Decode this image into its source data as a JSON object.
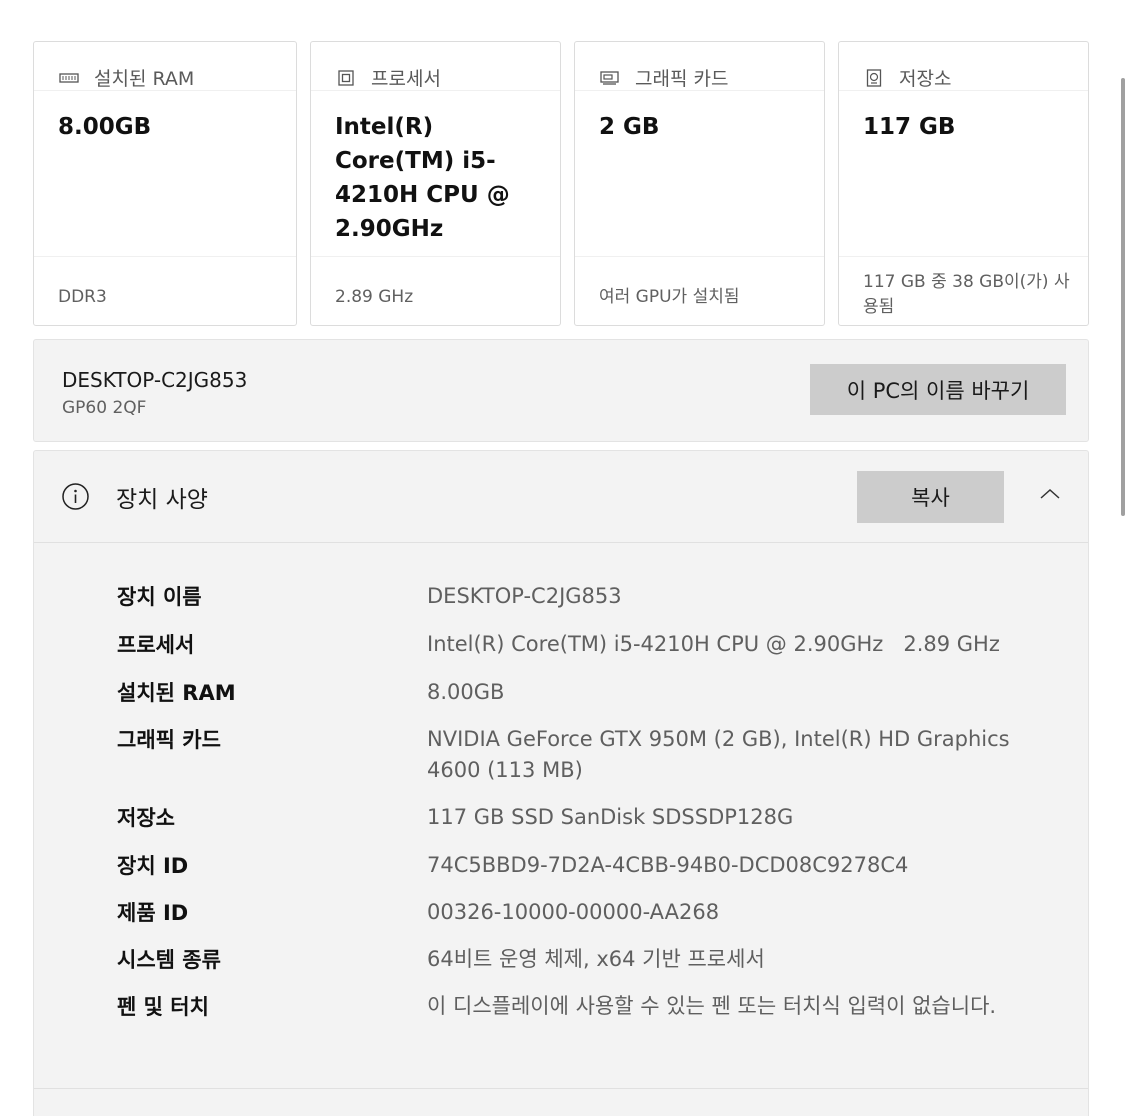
{
  "cards": [
    {
      "title": "설치된 RAM",
      "icon": "ram-icon",
      "value": "8.00GB",
      "footer": "DDR3"
    },
    {
      "title": "프로세서",
      "icon": "processor-icon",
      "value": "Intel(R) Core(TM) i5-4210H CPU @ 2.90GHz",
      "footer": "2.89 GHz"
    },
    {
      "title": "그래픽 카드",
      "icon": "graphics-card-icon",
      "value": "2 GB",
      "footer": "여러 GPU가 설치됨"
    },
    {
      "title": "저장소",
      "icon": "storage-icon",
      "value": "117 GB",
      "footer": "117 GB 중 38 GB이(가) 사용됨"
    }
  ],
  "device": {
    "name": "DESKTOP-C2JG853",
    "model": "GP60 2QF",
    "rename_label": "이 PC의 이름 바꾸기"
  },
  "specs": {
    "title": "장치 사양",
    "copy_label": "복사",
    "rows": [
      {
        "label": "장치 이름",
        "value": "DESKTOP-C2JG853"
      },
      {
        "label": "프로세서",
        "value": "Intel(R) Core(TM) i5-4210H CPU @ 2.90GHz   2.89 GHz"
      },
      {
        "label": "설치된 RAM",
        "value": "8.00GB"
      },
      {
        "label": "그래픽 카드",
        "value": "NVIDIA GeForce GTX 950M (2 GB), Intel(R) HD Graphics 4600 (113 MB)"
      },
      {
        "label": "저장소",
        "value": "117 GB SSD SanDisk SDSSDP128G"
      },
      {
        "label": "장치 ID",
        "value": "74C5BBD9-7D2A-4CBB-94B0-DCD08C9278C4"
      },
      {
        "label": "제품 ID",
        "value": "00326-10000-00000-AA268"
      },
      {
        "label": "시스템 종류",
        "value": "64비트 운영 체제, x64 기반 프로세서"
      },
      {
        "label": "펜 및 터치",
        "value": "이 디스플레이에 사용할 수 있는 펜 또는 터치식 입력이 없습니다."
      }
    ]
  },
  "colors": {
    "panel_bg": "#f3f3f3",
    "button_bg": "#cccccc",
    "secondary_text": "#5f5f5f"
  }
}
